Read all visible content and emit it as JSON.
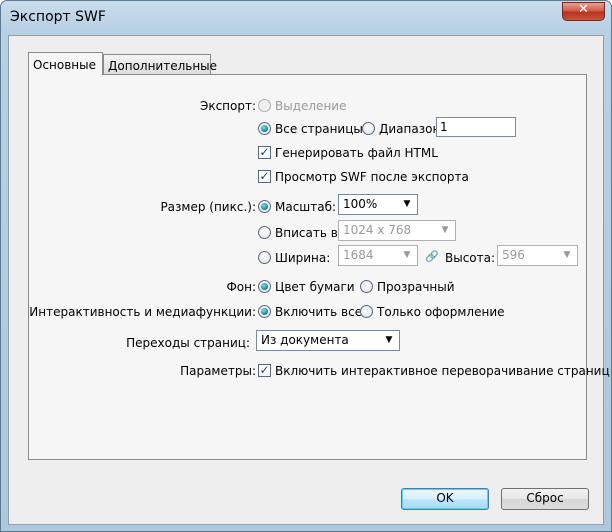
{
  "window": {
    "title": "Экспорт SWF",
    "close_glyph": "✕"
  },
  "tabs": [
    {
      "label": "Основные",
      "active": true
    },
    {
      "label": "Дополнительные",
      "active": false
    }
  ],
  "export": {
    "label": "Экспорт:",
    "selection": "Выделение",
    "all_pages": "Все страницы",
    "range": "Диапазон:",
    "range_value": "1",
    "generate_html": "Генерировать файл HTML",
    "preview": "Просмотр SWF после экспорта"
  },
  "size": {
    "label": "Размер (пикс.):",
    "scale_label": "Масштаб:",
    "scale_value": "100%",
    "fit_label": "Вписать в:",
    "fit_value": "1024 x 768",
    "width_label": "Ширина:",
    "width_value": "1684",
    "height_label": "Высота:",
    "height_value": "596"
  },
  "background": {
    "label": "Фон:",
    "paper": "Цвет бумаги",
    "transparent": "Прозрачный"
  },
  "interactivity": {
    "label": "Интерактивность и медиафункции:",
    "include_all": "Включить все",
    "appearance_only": "Только оформление"
  },
  "transitions": {
    "label": "Переходы страниц:",
    "value": "Из документа"
  },
  "options": {
    "label": "Параметры:",
    "curl": "Включить интерактивное переворачивание страниц"
  },
  "buttons": {
    "ok": "OK",
    "reset": "Сброс"
  },
  "icons": {
    "dropdown": "▼",
    "check": "✓",
    "chain": "🔗"
  },
  "colors": {
    "accent": "#0b7f93",
    "title_bar": "#b8d0e4",
    "disabled_text": "#9a9a9a"
  }
}
